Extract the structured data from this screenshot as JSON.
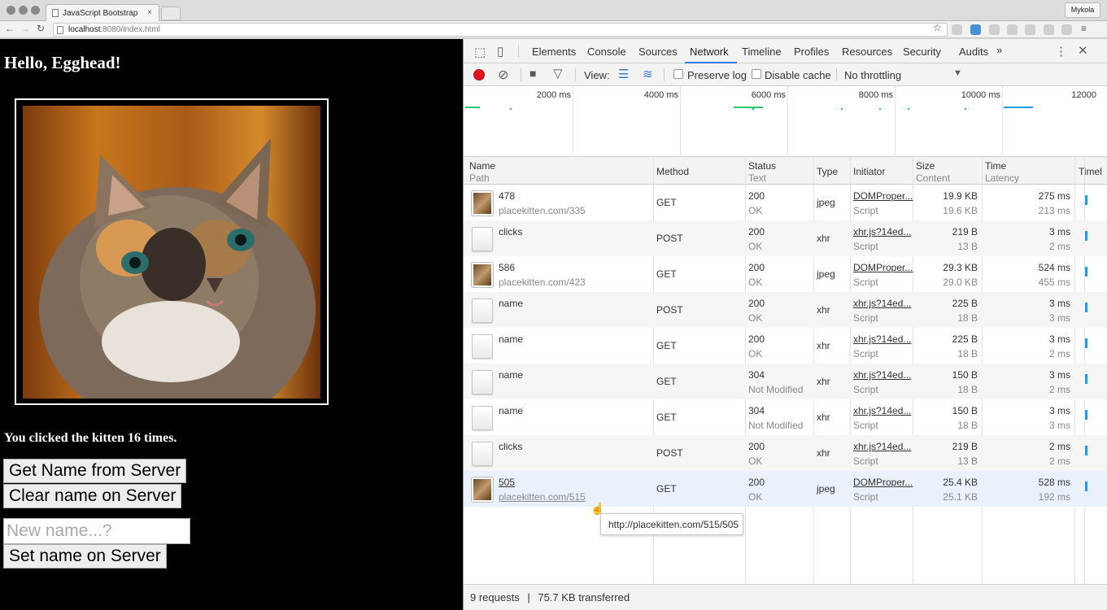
{
  "browser": {
    "tab_title": "JavaScript Bootstrap",
    "tab_close": "×",
    "profile": "Mykola",
    "url_host": "localhost",
    "url_path": ":8080/index.html"
  },
  "page": {
    "heading": "Hello, Egghead!",
    "click_text": "You clicked the kitten 16 times.",
    "get_name_button": "Get Name from Server",
    "clear_name_button": "Clear name on Server",
    "name_input_placeholder": "New name...?",
    "name_input_value": "",
    "set_name_button": "Set name on Server"
  },
  "devtools": {
    "tabs": [
      "Elements",
      "Console",
      "Sources",
      "Network",
      "Timeline",
      "Profiles",
      "Resources",
      "Security",
      "Audits"
    ],
    "more_tabs": "»",
    "active_tab": "Network",
    "view_label": "View:",
    "preserve_log": "Preserve log",
    "disable_cache": "Disable cache",
    "throttling": "No throttling",
    "overview_ticks": [
      "2000 ms",
      "4000 ms",
      "6000 ms",
      "8000 ms",
      "10000 ms",
      "12000"
    ],
    "columns": {
      "name": "Name",
      "name_sub": "Path",
      "method": "Method",
      "status": "Status",
      "status_sub": "Text",
      "type": "Type",
      "initiator": "Initiator",
      "size": "Size",
      "size_sub": "Content",
      "time": "Time",
      "time_sub": "Latency",
      "timeline": "Timel"
    },
    "requests": [
      {
        "name": "478",
        "path": "placekitten.com/335",
        "method": "GET",
        "status": "200",
        "status_text": "OK",
        "type": "jpeg",
        "initiator": "DOMProper...",
        "initiator_type": "Script",
        "size": "19.9 KB",
        "content": "19.6 KB",
        "time": "275 ms",
        "latency": "213 ms"
      },
      {
        "name": "clicks",
        "path": "",
        "method": "POST",
        "status": "200",
        "status_text": "OK",
        "type": "xhr",
        "initiator": "xhr.js?14ed...",
        "initiator_type": "Script",
        "size": "219 B",
        "content": "13 B",
        "time": "3 ms",
        "latency": "2 ms"
      },
      {
        "name": "586",
        "path": "placekitten.com/423",
        "method": "GET",
        "status": "200",
        "status_text": "OK",
        "type": "jpeg",
        "initiator": "DOMProper...",
        "initiator_type": "Script",
        "size": "29.3 KB",
        "content": "29.0 KB",
        "time": "524 ms",
        "latency": "455 ms"
      },
      {
        "name": "name",
        "path": "",
        "method": "POST",
        "status": "200",
        "status_text": "OK",
        "type": "xhr",
        "initiator": "xhr.js?14ed...",
        "initiator_type": "Script",
        "size": "225 B",
        "content": "18 B",
        "time": "3 ms",
        "latency": "3 ms"
      },
      {
        "name": "name",
        "path": "",
        "method": "GET",
        "status": "200",
        "status_text": "OK",
        "type": "xhr",
        "initiator": "xhr.js?14ed...",
        "initiator_type": "Script",
        "size": "225 B",
        "content": "18 B",
        "time": "3 ms",
        "latency": "2 ms"
      },
      {
        "name": "name",
        "path": "",
        "method": "GET",
        "status": "304",
        "status_text": "Not Modified",
        "type": "xhr",
        "initiator": "xhr.js?14ed...",
        "initiator_type": "Script",
        "size": "150 B",
        "content": "18 B",
        "time": "3 ms",
        "latency": "2 ms"
      },
      {
        "name": "name",
        "path": "",
        "method": "GET",
        "status": "304",
        "status_text": "Not Modified",
        "type": "xhr",
        "initiator": "xhr.js?14ed...",
        "initiator_type": "Script",
        "size": "150 B",
        "content": "18 B",
        "time": "3 ms",
        "latency": "3 ms"
      },
      {
        "name": "clicks",
        "path": "",
        "method": "POST",
        "status": "200",
        "status_text": "OK",
        "type": "xhr",
        "initiator": "xhr.js?14ed...",
        "initiator_type": "Script",
        "size": "219 B",
        "content": "13 B",
        "time": "2 ms",
        "latency": "2 ms"
      },
      {
        "name": "505",
        "path": "placekitten.com/515",
        "method": "GET",
        "status": "200",
        "status_text": "OK",
        "type": "jpeg",
        "initiator": "DOMProper...",
        "initiator_type": "Script",
        "size": "25.4 KB",
        "content": "25.1 KB",
        "time": "528 ms",
        "latency": "192 ms"
      }
    ],
    "tooltip": "http://placekitten.com/515/505",
    "status_requests": "9 requests",
    "status_divider": "|",
    "status_transferred": "75.7 KB transferred",
    "colors": {
      "record": "#e0141e",
      "accent": "#3879d9",
      "waterfall": "#1a9ee6"
    }
  }
}
